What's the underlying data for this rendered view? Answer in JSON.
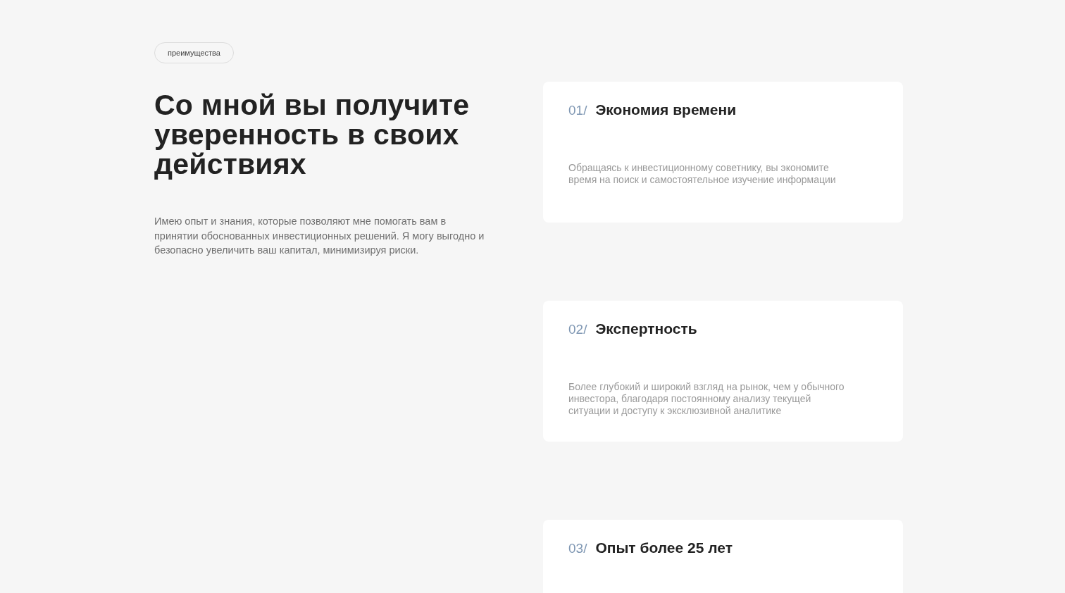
{
  "section_tag": "преимущества",
  "heading": "Со мной вы получите уверенность в своих действиях",
  "description": "Имею опыт и знания, которые позволяют мне помогать вам в принятии обоснованных инвестиционных решений. Я могу выгодно и безопасно увеличить ваш капитал, минимизируя риски.",
  "cards": [
    {
      "number": "01/",
      "title": "Экономия времени",
      "text": "Обращаясь к инвестиционному советнику, вы экономите время на поиск и самостоятельное изучение информации"
    },
    {
      "number": "02/",
      "title": "Экспертность",
      "text": "Более глубокий и широкий взгляд на рынок, чем у обычного инвестора, благодаря постоянному анализу текущей ситуации и доступу к эксклюзивной аналитике"
    },
    {
      "number": "03/",
      "title": "Опыт более 25 лет"
    }
  ]
}
